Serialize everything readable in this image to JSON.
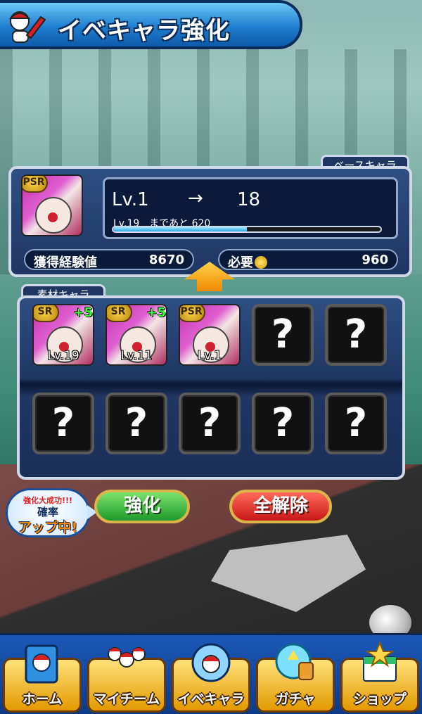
{
  "header": {
    "title": "イベキャラ強化",
    "icon": "player-swing-icon"
  },
  "base": {
    "tab_label": "ベースキャラ",
    "card": {
      "rarity": "PSR"
    },
    "level_from_label": "Lv.1",
    "arrow": "→",
    "level_to": "18",
    "next_text": "Lv.19　まであと 620",
    "progress": 0.5,
    "exp_label": "獲得経験値",
    "exp_value": "8670",
    "cost_label": "必要",
    "cost_value": "960"
  },
  "material": {
    "tab_label": "素材キャラ",
    "cards": [
      {
        "rarity": "SR",
        "plus": "+5",
        "level": "Lv.19"
      },
      {
        "rarity": "SR",
        "plus": "+5",
        "level": "Lv.11"
      },
      {
        "rarity": "PSR",
        "plus": "",
        "level": "Lv.1"
      }
    ],
    "empty_symbol": "?"
  },
  "promo": {
    "line1": "強化大成功!!!",
    "line2": "確率",
    "line3": "アップ中!"
  },
  "buttons": {
    "enhance": "強化",
    "clear_all": "全解除"
  },
  "nav": {
    "items": [
      {
        "label": "ホーム",
        "icon": "home-book-icon"
      },
      {
        "label": "マイチーム",
        "icon": "team-players-icon"
      },
      {
        "label": "イベキャラ",
        "icon": "event-chara-icon"
      },
      {
        "label": "ガチャ",
        "icon": "gacha-capsule-icon"
      },
      {
        "label": "ショップ",
        "icon": "shop-star-icon"
      }
    ]
  },
  "colors": {
    "header_blue": "#1e7fd0",
    "panel_navy": "#1f3663",
    "green_button": "#1e9a2a",
    "red_button": "#c81818",
    "nav_gold": "#e29a00"
  }
}
